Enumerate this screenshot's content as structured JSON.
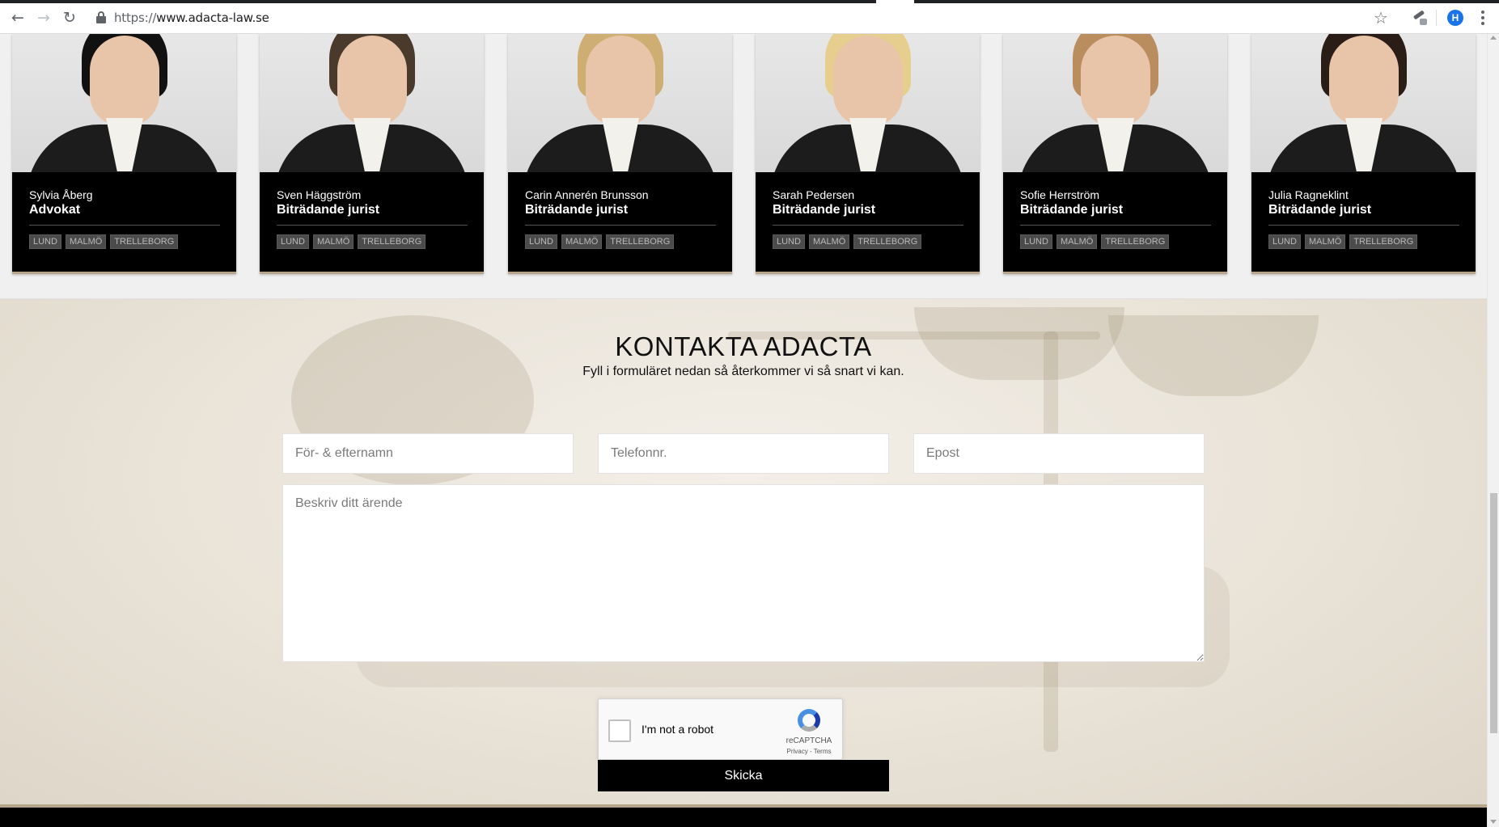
{
  "browser": {
    "url_scheme": "https://",
    "url_host": "www.adacta-law.se",
    "profile_initial": "H",
    "icons": {
      "back": "arrow-left-icon",
      "forward": "arrow-right-icon",
      "reload": "reload-icon",
      "lock": "lock-icon",
      "bookmark": "star-icon",
      "extension": "extension-icon",
      "menu": "more-vertical-icon"
    }
  },
  "team": {
    "members": [
      {
        "name": "Sylvia Åberg",
        "title": "Advokat",
        "tags": [
          "LUND",
          "MALMÖ",
          "TRELLEBORG"
        ],
        "hair_color": "#111111"
      },
      {
        "name": "Sven Häggström",
        "title": "Biträdande jurist",
        "tags": [
          "LUND",
          "MALMÖ",
          "TRELLEBORG"
        ],
        "hair_color": "#4a3a2c"
      },
      {
        "name": "Carin Annerén Brunsson",
        "title": "Biträdande jurist",
        "tags": [
          "LUND",
          "MALMÖ",
          "TRELLEBORG"
        ],
        "hair_color": "#cfae74"
      },
      {
        "name": "Sarah Pedersen",
        "title": "Biträdande jurist",
        "tags": [
          "LUND",
          "MALMÖ",
          "TRELLEBORG"
        ],
        "hair_color": "#e6cf8e"
      },
      {
        "name": "Sofie Herrström",
        "title": "Biträdande jurist",
        "tags": [
          "LUND",
          "MALMÖ",
          "TRELLEBORG"
        ],
        "hair_color": "#b98d5e"
      },
      {
        "name": "Julia Ragneklint",
        "title": "Biträdande jurist",
        "tags": [
          "LUND",
          "MALMÖ",
          "TRELLEBORG"
        ],
        "hair_color": "#2a1d17"
      }
    ]
  },
  "contact": {
    "title": "KONTAKTA ADACTA",
    "subtitle": "Fyll i formuläret nedan så återkommer vi så snart vi kan.",
    "name_placeholder": "För- & efternamn",
    "phone_placeholder": "Telefonnr.",
    "email_placeholder": "Epost",
    "message_placeholder": "Beskriv ditt ärende",
    "recaptcha_label": "I'm not a robot",
    "recaptcha_brand": "reCAPTCHA",
    "recaptcha_terms": "Privacy - Terms",
    "submit_label": "Skicka"
  },
  "colors": {
    "accent": "#b6a48b",
    "card_bg": "#000000",
    "tag_bg": "#4b4b4b"
  }
}
